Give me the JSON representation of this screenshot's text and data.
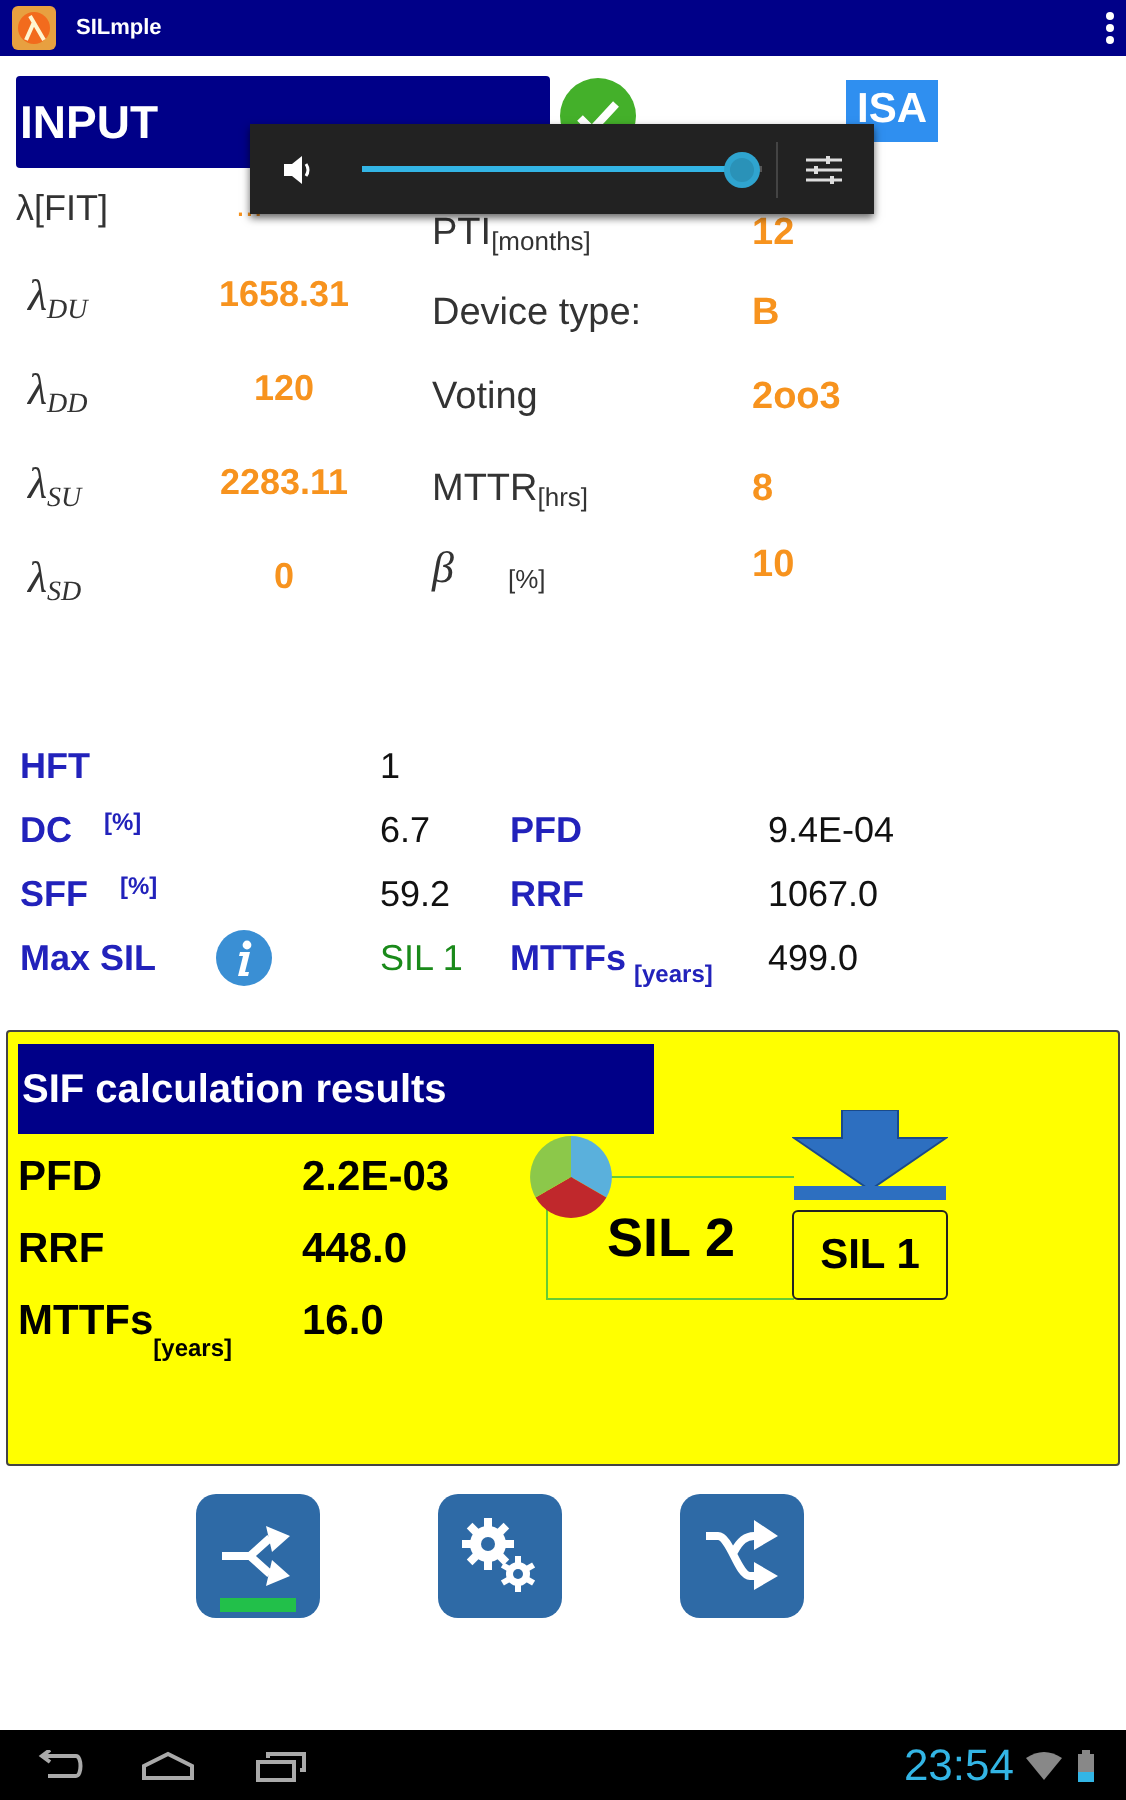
{
  "app_bar": {
    "title": "SILmple"
  },
  "input": {
    "title": "INPUT",
    "standard": "ISA",
    "lambda_header": {
      "label": "λ[FIT]",
      "value": "..."
    },
    "lambdas": [
      {
        "symbol": "λ",
        "sub": "DU",
        "value": "1658.31"
      },
      {
        "symbol": "λ",
        "sub": "DD",
        "value": "120"
      },
      {
        "symbol": "λ",
        "sub": "SU",
        "value": "2283.11"
      },
      {
        "symbol": "λ",
        "sub": "SD",
        "value": "0"
      }
    ],
    "params": [
      {
        "label": "PTI",
        "unit": "[months]",
        "value": "12"
      },
      {
        "label": "Device type:",
        "value": "B"
      },
      {
        "label": "Voting",
        "value": "2oo3"
      },
      {
        "label": "MTTR",
        "unit": "[hrs]",
        "value": "8"
      },
      {
        "label": "β",
        "unit": "[%]",
        "value": "10",
        "kind": "symbol"
      }
    ]
  },
  "volume": {
    "level": 0.95
  },
  "summary": [
    {
      "label": "HFT",
      "info": false,
      "value": "1",
      "highlight": false
    },
    {
      "label": "DC",
      "unit": "[%]",
      "info": false,
      "value": "6.7",
      "highlight": false,
      "label2": "PFD",
      "value2": "9.4E-04"
    },
    {
      "label": "SFF",
      "unit": "[%]",
      "info": false,
      "value": "59.2",
      "highlight": false,
      "label2": "RRF",
      "value2": "1067.0"
    },
    {
      "label": "Max SIL",
      "info": true,
      "value": "SIL 1",
      "highlight": true,
      "label2": "MTTFs",
      "unit2": "[years]",
      "value2": "499.0"
    }
  ],
  "results": {
    "title": "SIF calculation results",
    "rows": [
      {
        "label": "PFD",
        "value": "2.2E-03"
      },
      {
        "label": "RRF",
        "value": "448.0"
      },
      {
        "label": "MTTFs",
        "unit": "[years]",
        "value": "16.0"
      }
    ],
    "calculated_sil": "SIL 2",
    "max_sil": "SIL 1"
  },
  "toolbar": [
    {
      "kind": "split",
      "selected": true
    },
    {
      "kind": "gears",
      "selected": false
    },
    {
      "kind": "shuffle",
      "selected": false
    }
  ],
  "status_bar": {
    "time": "23:54"
  }
}
